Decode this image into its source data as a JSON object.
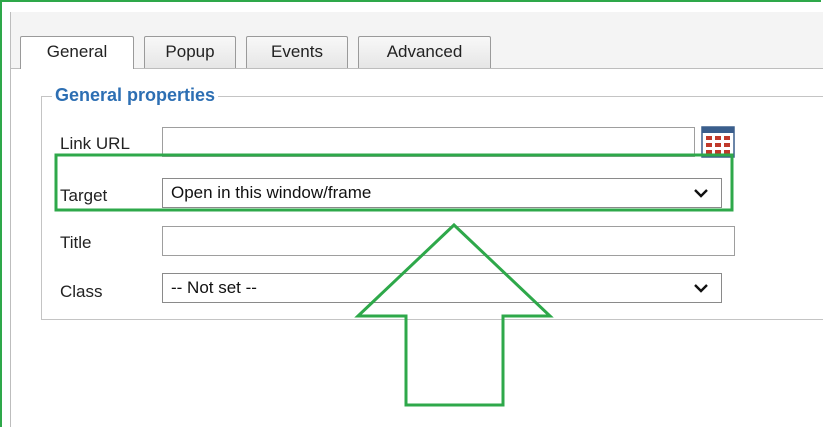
{
  "tabs": [
    {
      "label": "General",
      "active": true
    },
    {
      "label": "Popup",
      "active": false
    },
    {
      "label": "Events",
      "active": false
    },
    {
      "label": "Advanced",
      "active": false
    }
  ],
  "section": {
    "legend": "General properties"
  },
  "fields": {
    "link_url": {
      "label": "Link URL",
      "value": "",
      "picker_icon": "calendar-grid-icon"
    },
    "target": {
      "label": "Target",
      "selected": "Open in this window/frame"
    },
    "title": {
      "label": "Title",
      "value": ""
    },
    "class": {
      "label": "Class",
      "selected": "-- Not set --"
    }
  },
  "colors": {
    "highlight": "#2ea84a",
    "legend": "#2d6fb3"
  }
}
